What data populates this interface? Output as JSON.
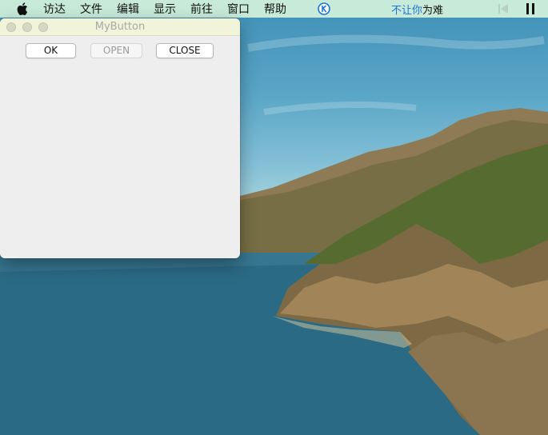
{
  "menubar": {
    "items": [
      "访达",
      "文件",
      "编辑",
      "显示",
      "前往",
      "窗口",
      "帮助"
    ],
    "status_part1": "不让你",
    "status_part2": "为难",
    "icons": [
      "apple-icon",
      "k-circle-icon",
      "previous-track-icon",
      "pause-icon"
    ]
  },
  "window": {
    "title": "MyButton",
    "buttons": {
      "ok": "OK",
      "open": "OPEN",
      "close": "CLOSE"
    },
    "open_enabled": false
  },
  "colors": {
    "menubar_bg": "#c7ead9",
    "titlebar_bg": "#f2f4d9",
    "window_bg": "#eeeeee",
    "status_blue": "#1e73d8"
  }
}
